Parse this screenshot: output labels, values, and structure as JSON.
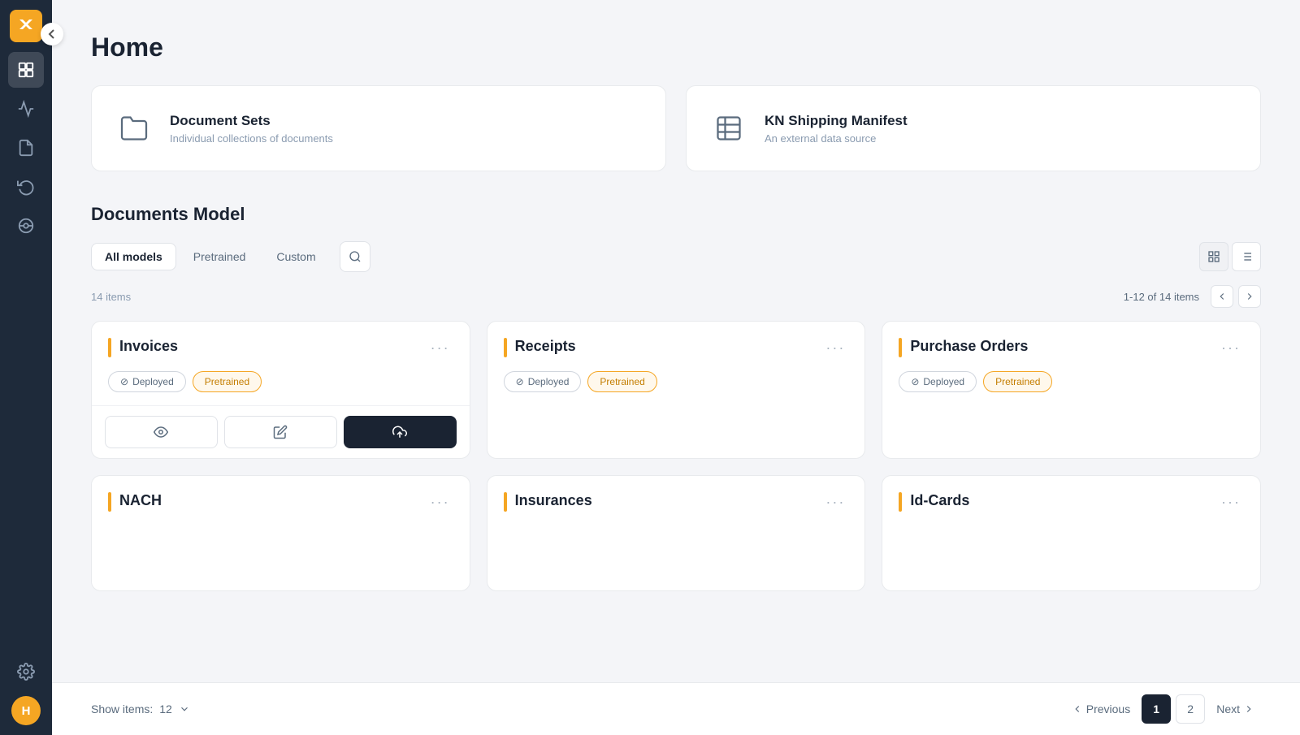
{
  "sidebar": {
    "logo_label": "X",
    "avatar_label": "H",
    "toggle_title": "Collapse",
    "items": [
      {
        "id": "documents",
        "label": "Documents",
        "active": true
      },
      {
        "id": "analytics",
        "label": "Analytics",
        "active": false
      },
      {
        "id": "pdf",
        "label": "PDF",
        "active": false
      },
      {
        "id": "history",
        "label": "History",
        "active": false
      },
      {
        "id": "integrations",
        "label": "Integrations",
        "active": false
      },
      {
        "id": "settings",
        "label": "Settings",
        "active": false
      }
    ]
  },
  "page": {
    "title": "Home"
  },
  "top_cards": [
    {
      "id": "document-sets",
      "title": "Document Sets",
      "description": "Individual collections of documents",
      "icon": "folder"
    },
    {
      "id": "kn-shipping",
      "title": "KN Shipping Manifest",
      "description": "An external data source",
      "icon": "table"
    }
  ],
  "documents_model": {
    "section_title": "Documents Model",
    "filter_tabs": [
      {
        "id": "all",
        "label": "All models",
        "active": true
      },
      {
        "id": "pretrained",
        "label": "Pretrained",
        "active": false
      },
      {
        "id": "custom",
        "label": "Custom",
        "active": false
      }
    ],
    "items_count": "14 items",
    "pagination_range": "1-12 of 14 items",
    "models": [
      {
        "id": "invoices",
        "title": "Invoices",
        "badges": [
          "Deployed",
          "Pretrained"
        ],
        "has_actions": true
      },
      {
        "id": "receipts",
        "title": "Receipts",
        "badges": [
          "Deployed",
          "Pretrained"
        ],
        "has_actions": false
      },
      {
        "id": "purchase-orders",
        "title": "Purchase Orders",
        "badges": [
          "Deployed",
          "Pretrained"
        ],
        "has_actions": false
      },
      {
        "id": "nach",
        "title": "NACH",
        "badges": [],
        "has_actions": false
      },
      {
        "id": "insurances",
        "title": "Insurances",
        "badges": [],
        "has_actions": false
      },
      {
        "id": "id-cards",
        "title": "Id-Cards",
        "badges": [],
        "has_actions": false
      }
    ]
  },
  "bottom_bar": {
    "show_items_label": "Show items:",
    "show_items_value": "12",
    "prev_label": "Previous",
    "next_label": "Next",
    "pages": [
      "1",
      "2"
    ],
    "current_page": "1"
  }
}
